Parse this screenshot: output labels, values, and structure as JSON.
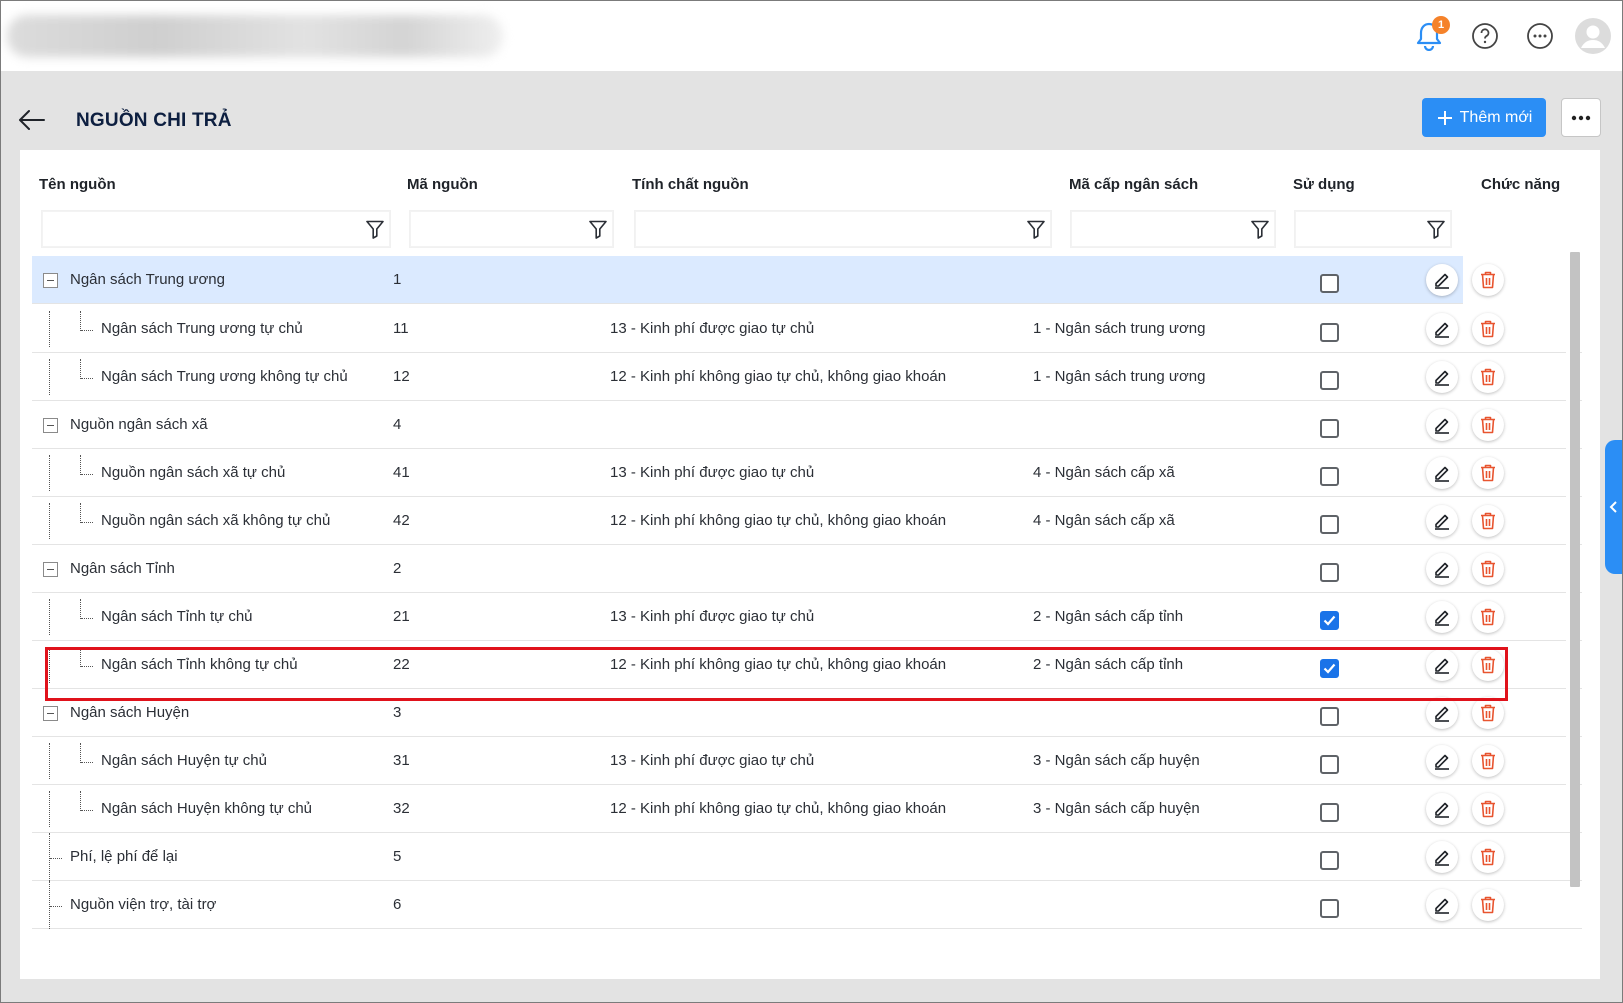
{
  "header": {
    "app_title_blurred": "",
    "notification_count": "1",
    "icons": [
      "bell-icon",
      "help-icon",
      "more-horizontal-icon",
      "user-avatar-icon"
    ]
  },
  "page": {
    "title": "NGUỒN CHI TRẢ",
    "add_button_label": "Thêm mới"
  },
  "columns": [
    "Tên nguồn",
    "Mã nguồn",
    "Tính chất nguồn",
    "Mã cấp ngân sách",
    "Sử dụng",
    "Chức năng"
  ],
  "rows": [
    {
      "name": "Ngân sách Trung ương",
      "code": "1",
      "nature": "",
      "level": "",
      "used": false,
      "depth": 0,
      "expandable": true,
      "selected": true
    },
    {
      "name": "Ngân sách Trung ương tự chủ",
      "code": "11",
      "nature": "13 - Kinh phí được giao tự chủ",
      "level": "1 - Ngân sách trung ương",
      "used": false,
      "depth": 1
    },
    {
      "name": "Ngân sách Trung ương không tự chủ",
      "code": "12",
      "nature": "12 - Kinh phí không giao tự chủ, không giao khoán",
      "level": "1 - Ngân sách trung ương",
      "used": false,
      "depth": 1
    },
    {
      "name": "Nguồn ngân sách xã",
      "code": "4",
      "nature": "",
      "level": "",
      "used": false,
      "depth": 0,
      "expandable": true
    },
    {
      "name": "Nguồn ngân sách xã tự chủ",
      "code": "41",
      "nature": "13 - Kinh phí được giao tự chủ",
      "level": "4 - Ngân sách cấp xã",
      "used": false,
      "depth": 1
    },
    {
      "name": "Nguồn ngân sách xã không tự chủ",
      "code": "42",
      "nature": "12 - Kinh phí không giao tự chủ, không giao khoán",
      "level": "4 - Ngân sách cấp xã",
      "used": false,
      "depth": 1
    },
    {
      "name": "Ngân sách Tỉnh",
      "code": "2",
      "nature": "",
      "level": "",
      "used": false,
      "depth": 0,
      "expandable": true
    },
    {
      "name": "Ngân sách Tỉnh tự chủ",
      "code": "21",
      "nature": "13 - Kinh phí được giao tự chủ",
      "level": "2 - Ngân sách cấp tỉnh",
      "used": true,
      "depth": 1
    },
    {
      "name": "Ngân sách Tỉnh không tự chủ",
      "code": "22",
      "nature": "12 - Kinh phí không giao tự chủ, không giao khoán",
      "level": "2 - Ngân sách cấp tỉnh",
      "used": true,
      "depth": 1,
      "highlighted": true
    },
    {
      "name": "Ngân sách Huyện",
      "code": "3",
      "nature": "",
      "level": "",
      "used": false,
      "depth": 0,
      "expandable": true
    },
    {
      "name": "Ngân sách Huyện tự chủ",
      "code": "31",
      "nature": "13 - Kinh phí được giao tự chủ",
      "level": "3 - Ngân sách cấp huyện",
      "used": false,
      "depth": 1
    },
    {
      "name": "Ngân sách Huyện không tự chủ",
      "code": "32",
      "nature": "12 - Kinh phí không giao tự chủ, không giao khoán",
      "level": "3 - Ngân sách cấp huyện",
      "used": false,
      "depth": 1
    },
    {
      "name": "Phí, lệ phí để lại",
      "code": "5",
      "nature": "",
      "level": "",
      "used": false,
      "depth": 0,
      "expandable": false
    },
    {
      "name": "Nguồn viện trợ, tài trợ",
      "code": "6",
      "nature": "",
      "level": "",
      "used": false,
      "depth": 0,
      "expandable": false
    }
  ],
  "colors": {
    "accent": "#2b8ef5",
    "selected_row": "#dbeaff",
    "delete": "#e8542f",
    "highlight_box": "#e0121b",
    "checkbox_on": "#1a73e8"
  }
}
